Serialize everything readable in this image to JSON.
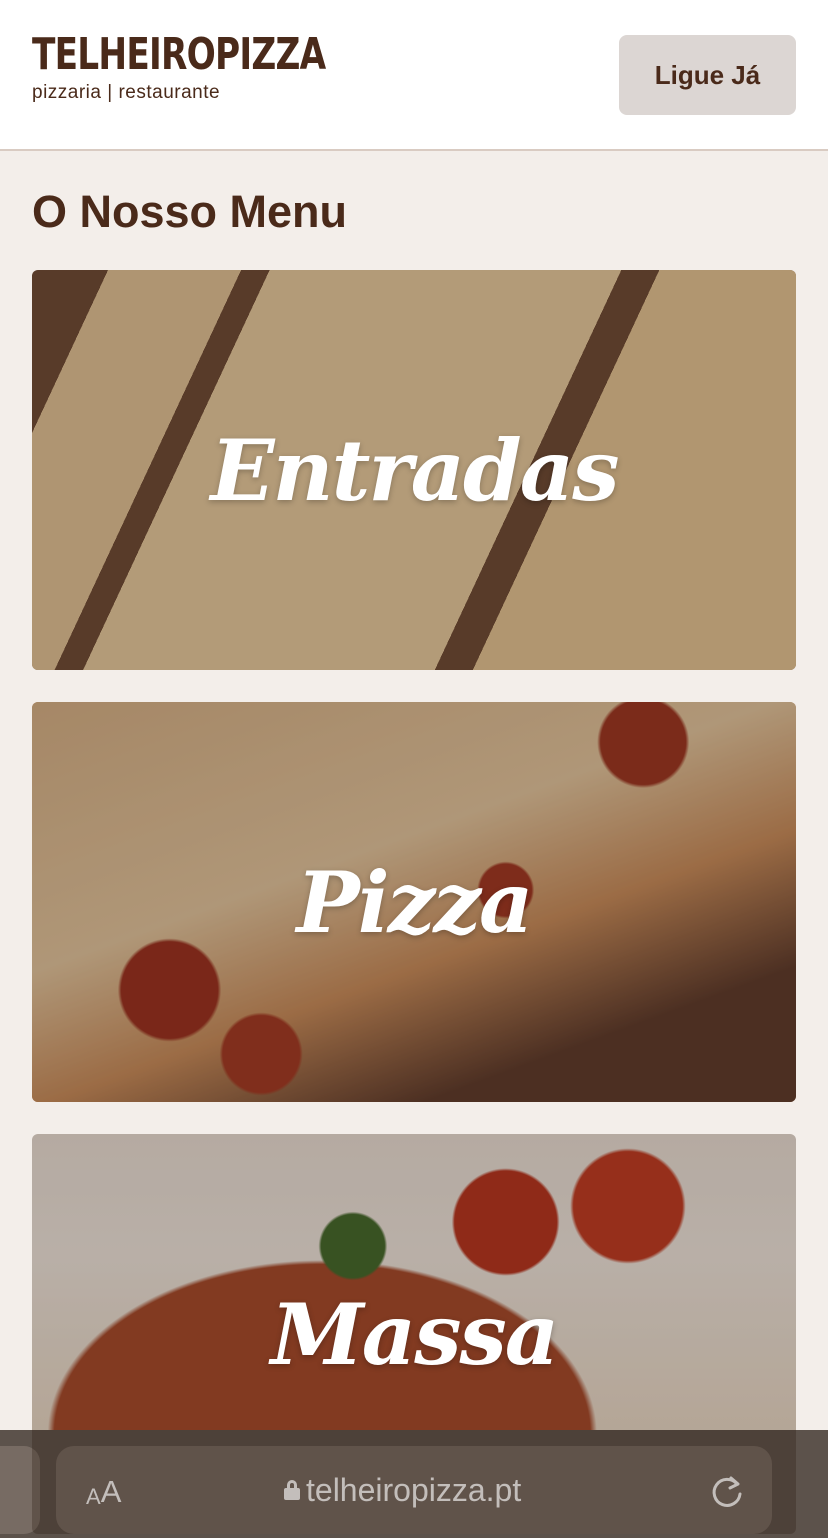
{
  "header": {
    "brand_name": "TELHEIROPIZZA",
    "brand_tagline": "pizzaria | restaurante",
    "call_button_label": "Ligue Já"
  },
  "main": {
    "title": "O Nosso Menu",
    "categories": [
      {
        "label": "Entradas"
      },
      {
        "label": "Pizza"
      },
      {
        "label": "Massa"
      }
    ]
  },
  "browser": {
    "text_size_small": "A",
    "text_size_large": "A",
    "url": "telheiropizza.pt"
  },
  "colors": {
    "brand_brown": "#4a2a1a",
    "page_background": "#f3eeea",
    "button_background": "#dcd6d3"
  }
}
